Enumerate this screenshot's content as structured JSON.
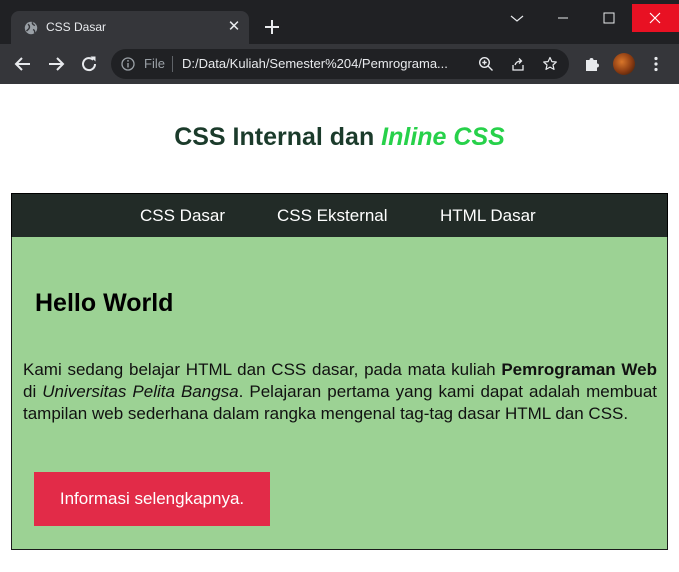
{
  "browser": {
    "tab_title": "CSS Dasar",
    "scheme_label": "File",
    "url": "D:/Data/Kuliah/Semester%204/Pemrograma...",
    "icons": {
      "favicon": "globe-icon",
      "tab_close": "close-icon",
      "new_tab": "plus-icon",
      "back": "arrow-left-icon",
      "forward": "arrow-right-icon",
      "reload": "reload-icon",
      "info": "info-icon",
      "zoom": "zoom-icon",
      "share": "share-icon",
      "bookmark": "star-icon",
      "extensions": "puzzle-icon",
      "menu": "kebab-menu-icon"
    },
    "colors": {
      "tabstrip": "#202124",
      "toolbar": "#35363a",
      "close_button": "#e81123"
    }
  },
  "page": {
    "title_main": "CSS Internal dan ",
    "title_emphasis": "Inline CSS",
    "nav": [
      "CSS Dasar",
      "CSS Eksternal",
      "HTML Dasar"
    ],
    "heading": "Hello World",
    "paragraph": {
      "p1": "Kami sedang belajar HTML dan CSS dasar, pada mata kuliah ",
      "bold": "Pemrograman Web",
      "p2": " di ",
      "italic": "Universitas Pelita Bangsa",
      "p3": ". Pelajaran pertama yang kami dapat adalah membuat tampilan web sederhana dalam rangka mengenal tag-tag dasar HTML dan CSS."
    },
    "button_label": "Informasi selengkapnya.",
    "colors": {
      "title": "#1b3b2b",
      "title_emphasis": "#27d14a",
      "navbar": "#222b27",
      "content_bg": "#9cd294",
      "button": "#e22b48"
    }
  }
}
